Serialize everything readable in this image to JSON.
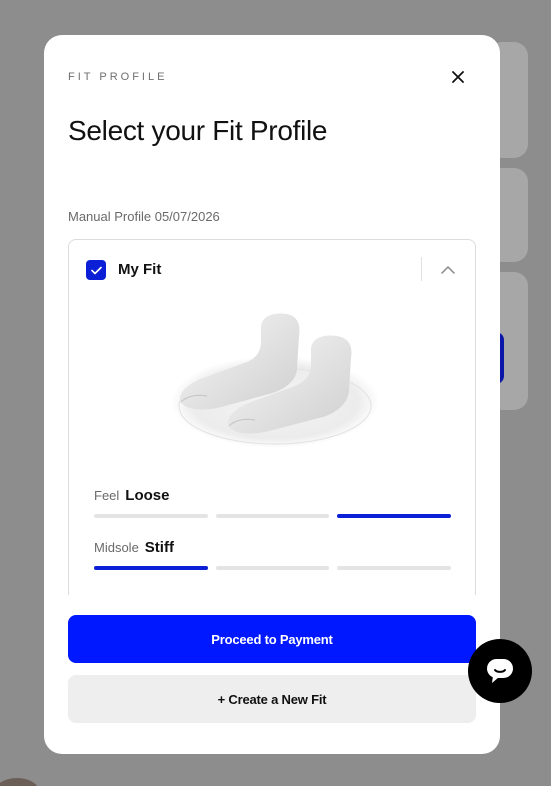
{
  "modal": {
    "eyebrow": "FIT PROFILE",
    "title": "Select your Fit Profile",
    "close_icon": "close-icon",
    "profile_label": "Manual Profile 05/07/2026"
  },
  "fit_card": {
    "name": "My Fit",
    "checked": true,
    "expanded": true,
    "metrics": [
      {
        "label": "Feel",
        "value": "Loose",
        "level_index": 2,
        "level_count": 3
      },
      {
        "label": "Midsole",
        "value": "Stiff",
        "level_index": 0,
        "level_count": 3
      }
    ]
  },
  "actions": {
    "primary": "Proceed to Payment",
    "secondary": "+ Create a New Fit"
  },
  "chat": {
    "icon": "chat-bubble-icon"
  },
  "colors": {
    "accent": "#0018ff",
    "accent_dark": "#0a1fd6",
    "overlay": "#8d8d8d",
    "bar_inactive": "#e4e4e4"
  }
}
